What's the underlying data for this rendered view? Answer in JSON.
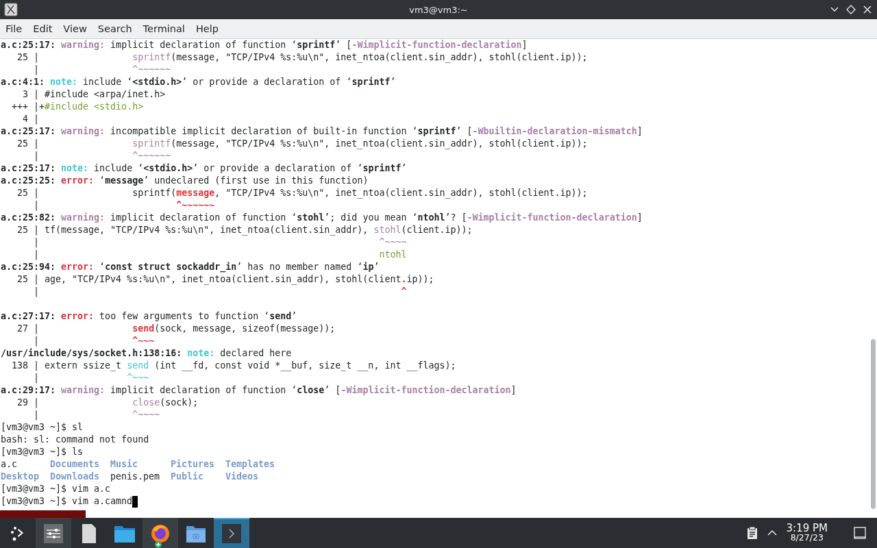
{
  "window": {
    "title": "vm3@vm3:~"
  },
  "menu": [
    "File",
    "Edit",
    "View",
    "Search",
    "Terminal",
    "Help"
  ],
  "terminal": {
    "lines": [
      {
        "kind": "output",
        "segments": [
          {
            "kind": "bold",
            "text": "a.c:25:17: "
          },
          {
            "kind": "warning",
            "text": "warning:"
          },
          {
            "kind": "plain",
            "text": " implicit declaration of function ‘"
          },
          {
            "kind": "bold",
            "text": "sprintf"
          },
          {
            "kind": "plain",
            "text": "’ ["
          },
          {
            "kind": "flag",
            "text": "-Wimplicit-function-declaration"
          },
          {
            "kind": "plain",
            "text": "]"
          }
        ]
      },
      {
        "kind": "output",
        "segments": [
          {
            "kind": "plain",
            "text": "   25 |                 "
          },
          {
            "kind": "code-warning",
            "text": "sprintf"
          },
          {
            "kind": "plain",
            "text": "(message, \"TCP/IPv4 %s:%u\\n\", inet_ntoa(client.sin_addr), stohl(client.ip));"
          }
        ]
      },
      {
        "kind": "output",
        "segments": [
          {
            "kind": "plain",
            "text": "      |                 "
          },
          {
            "kind": "code-warning",
            "text": "^~~~~~~"
          }
        ]
      },
      {
        "kind": "output",
        "segments": [
          {
            "kind": "bold",
            "text": "a.c:4:1: "
          },
          {
            "kind": "note",
            "text": "note:"
          },
          {
            "kind": "plain",
            "text": " include ‘"
          },
          {
            "kind": "bold",
            "text": "<stdio.h>"
          },
          {
            "kind": "plain",
            "text": "’ or provide a declaration of ‘"
          },
          {
            "kind": "bold",
            "text": "sprintf"
          },
          {
            "kind": "plain",
            "text": "’"
          }
        ]
      },
      {
        "kind": "output",
        "segments": [
          {
            "kind": "plain",
            "text": "    3 | #include <arpa/inet.h>"
          }
        ]
      },
      {
        "kind": "output",
        "segments": [
          {
            "kind": "plain",
            "text": "  +++ |+"
          },
          {
            "kind": "fixit",
            "text": "#include <stdio.h>"
          }
        ]
      },
      {
        "kind": "output",
        "segments": [
          {
            "kind": "plain",
            "text": "    4 |"
          }
        ]
      },
      {
        "kind": "output",
        "segments": [
          {
            "kind": "bold",
            "text": "a.c:25:17: "
          },
          {
            "kind": "warning",
            "text": "warning:"
          },
          {
            "kind": "plain",
            "text": " incompatible implicit declaration of built-in function ‘"
          },
          {
            "kind": "bold",
            "text": "sprintf"
          },
          {
            "kind": "plain",
            "text": "’ ["
          },
          {
            "kind": "flag",
            "text": "-Wbuiltin-declaration-mismatch"
          },
          {
            "kind": "plain",
            "text": "]"
          }
        ]
      },
      {
        "kind": "output",
        "segments": [
          {
            "kind": "plain",
            "text": "   25 |                 "
          },
          {
            "kind": "code-warning",
            "text": "sprintf"
          },
          {
            "kind": "plain",
            "text": "(message, \"TCP/IPv4 %s:%u\\n\", inet_ntoa(client.sin_addr), stohl(client.ip));"
          }
        ]
      },
      {
        "kind": "output",
        "segments": [
          {
            "kind": "plain",
            "text": "      |                 "
          },
          {
            "kind": "code-warning",
            "text": "^~~~~~~"
          }
        ]
      },
      {
        "kind": "output",
        "segments": [
          {
            "kind": "bold",
            "text": "a.c:25:17: "
          },
          {
            "kind": "note",
            "text": "note:"
          },
          {
            "kind": "plain",
            "text": " include ‘"
          },
          {
            "kind": "bold",
            "text": "<stdio.h>"
          },
          {
            "kind": "plain",
            "text": "’ or provide a declaration of ‘"
          },
          {
            "kind": "bold",
            "text": "sprintf"
          },
          {
            "kind": "plain",
            "text": "’"
          }
        ]
      },
      {
        "kind": "output",
        "segments": [
          {
            "kind": "bold",
            "text": "a.c:25:25: "
          },
          {
            "kind": "error",
            "text": "error:"
          },
          {
            "kind": "plain",
            "text": " ‘"
          },
          {
            "kind": "bold",
            "text": "message"
          },
          {
            "kind": "plain",
            "text": "’ undeclared (first use in this function)"
          }
        ]
      },
      {
        "kind": "output",
        "segments": [
          {
            "kind": "plain",
            "text": "   25 |                 sprintf("
          },
          {
            "kind": "code-error",
            "text": "message"
          },
          {
            "kind": "plain",
            "text": ", \"TCP/IPv4 %s:%u\\n\", inet_ntoa(client.sin_addr), stohl(client.ip));"
          }
        ]
      },
      {
        "kind": "output",
        "segments": [
          {
            "kind": "plain",
            "text": "      |                         "
          },
          {
            "kind": "code-error",
            "text": "^~~~~~~"
          }
        ]
      },
      {
        "kind": "output",
        "segments": [
          {
            "kind": "bold",
            "text": "a.c:25:82: "
          },
          {
            "kind": "warning",
            "text": "warning:"
          },
          {
            "kind": "plain",
            "text": " implicit declaration of function ‘"
          },
          {
            "kind": "bold",
            "text": "stohl"
          },
          {
            "kind": "plain",
            "text": "’; did you mean ‘"
          },
          {
            "kind": "bold",
            "text": "ntohl"
          },
          {
            "kind": "plain",
            "text": "’? ["
          },
          {
            "kind": "flag",
            "text": "-Wimplicit-function-declaration"
          },
          {
            "kind": "plain",
            "text": "]"
          }
        ]
      },
      {
        "kind": "output",
        "segments": [
          {
            "kind": "plain",
            "text": "   25 | tf(message, \"TCP/IPv4 %s:%u\\n\", inet_ntoa(client.sin_addr), "
          },
          {
            "kind": "code-warning",
            "text": "stohl"
          },
          {
            "kind": "plain",
            "text": "(client.ip));"
          }
        ]
      },
      {
        "kind": "output",
        "segments": [
          {
            "kind": "plain",
            "text": "      |                                                              "
          },
          {
            "kind": "code-warning",
            "text": "^~~~~"
          }
        ]
      },
      {
        "kind": "output",
        "segments": [
          {
            "kind": "plain",
            "text": "      |                                                              "
          },
          {
            "kind": "fixit",
            "text": "ntohl"
          }
        ]
      },
      {
        "kind": "output",
        "segments": [
          {
            "kind": "bold",
            "text": "a.c:25:94: "
          },
          {
            "kind": "error",
            "text": "error:"
          },
          {
            "kind": "plain",
            "text": " ‘"
          },
          {
            "kind": "bold",
            "text": "const struct sockaddr_in"
          },
          {
            "kind": "plain",
            "text": "’ has no member named ‘"
          },
          {
            "kind": "bold",
            "text": "ip"
          },
          {
            "kind": "plain",
            "text": "’"
          }
        ]
      },
      {
        "kind": "output",
        "segments": [
          {
            "kind": "plain",
            "text": "   25 | age, \"TCP/IPv4 %s:%u\\n\", inet_ntoa(client.sin_addr), stohl(client"
          },
          {
            "kind": "code-error",
            "text": "."
          },
          {
            "kind": "plain",
            "text": "ip));"
          }
        ]
      },
      {
        "kind": "output",
        "segments": [
          {
            "kind": "plain",
            "text": "      |                                                                  "
          },
          {
            "kind": "code-error",
            "text": "^"
          }
        ]
      },
      {
        "kind": "blank"
      },
      {
        "kind": "output",
        "segments": [
          {
            "kind": "bold",
            "text": "a.c:27:17: "
          },
          {
            "kind": "error",
            "text": "error:"
          },
          {
            "kind": "plain",
            "text": " too few arguments to function ‘"
          },
          {
            "kind": "bold",
            "text": "send"
          },
          {
            "kind": "plain",
            "text": "’"
          }
        ]
      },
      {
        "kind": "output",
        "segments": [
          {
            "kind": "plain",
            "text": "   27 |                 "
          },
          {
            "kind": "code-error",
            "text": "send"
          },
          {
            "kind": "plain",
            "text": "(sock, message, sizeof(message));"
          }
        ]
      },
      {
        "kind": "output",
        "segments": [
          {
            "kind": "plain",
            "text": "      |                 "
          },
          {
            "kind": "code-error",
            "text": "^~~~"
          }
        ]
      },
      {
        "kind": "output",
        "segments": [
          {
            "kind": "bold",
            "text": "/usr/include/sys/socket.h:138:16: "
          },
          {
            "kind": "note",
            "text": "note:"
          },
          {
            "kind": "plain",
            "text": " declared here"
          }
        ]
      },
      {
        "kind": "output",
        "segments": [
          {
            "kind": "plain",
            "text": "  138 | extern ssize_t "
          },
          {
            "kind": "code-note",
            "text": "send"
          },
          {
            "kind": "plain",
            "text": " (int __fd, const void *__buf, size_t __n, int __flags);"
          }
        ]
      },
      {
        "kind": "output",
        "segments": [
          {
            "kind": "plain",
            "text": "      |                "
          },
          {
            "kind": "code-note",
            "text": "^~~~"
          }
        ]
      },
      {
        "kind": "output",
        "segments": [
          {
            "kind": "bold",
            "text": "a.c:29:17: "
          },
          {
            "kind": "warning",
            "text": "warning:"
          },
          {
            "kind": "plain",
            "text": " implicit declaration of function ‘"
          },
          {
            "kind": "bold",
            "text": "close"
          },
          {
            "kind": "plain",
            "text": "’ ["
          },
          {
            "kind": "flag",
            "text": "-Wimplicit-function-declaration"
          },
          {
            "kind": "plain",
            "text": "]"
          }
        ]
      },
      {
        "kind": "output",
        "segments": [
          {
            "kind": "plain",
            "text": "   29 |                 "
          },
          {
            "kind": "code-warning",
            "text": "close"
          },
          {
            "kind": "plain",
            "text": "(sock);"
          }
        ]
      },
      {
        "kind": "output",
        "segments": [
          {
            "kind": "plain",
            "text": "      |                 "
          },
          {
            "kind": "code-warning",
            "text": "^~~~~"
          }
        ]
      },
      {
        "kind": "output",
        "segments": [
          {
            "kind": "plain",
            "text": "[vm3@vm3 ~]$ sl"
          }
        ]
      },
      {
        "kind": "output",
        "segments": [
          {
            "kind": "plain",
            "text": "bash: sl: command not found"
          }
        ]
      },
      {
        "kind": "output",
        "segments": [
          {
            "kind": "plain",
            "text": "[vm3@vm3 ~]$ ls"
          }
        ]
      },
      {
        "kind": "listing",
        "entries": [
          {
            "kind": "file",
            "text": "a.c"
          },
          {
            "kind": "directory",
            "text": "Documents"
          },
          {
            "kind": "directory",
            "text": "Music"
          },
          {
            "kind": "directory",
            "text": "Pictures"
          },
          {
            "kind": "directory",
            "text": "Templates"
          }
        ]
      },
      {
        "kind": "listing",
        "entries": [
          {
            "kind": "directory",
            "text": "Desktop"
          },
          {
            "kind": "directory",
            "text": "Downloads"
          },
          {
            "kind": "file",
            "text": "penis.pem"
          },
          {
            "kind": "directory",
            "text": "Public"
          },
          {
            "kind": "directory",
            "text": "Videos"
          }
        ]
      },
      {
        "kind": "output",
        "segments": [
          {
            "kind": "plain",
            "text": "[vm3@vm3 ~]$ vim a.c"
          }
        ]
      },
      {
        "kind": "output",
        "segments": [
          {
            "kind": "plain",
            "text": "[vm3@vm3 ~]$ vim a.camnd"
          }
        ],
        "cursor": true
      }
    ]
  },
  "taskbar": {
    "apps": [
      {
        "kind": "launcher",
        "highlighted": false,
        "selected": false
      },
      {
        "kind": "settings",
        "highlighted": true,
        "selected": false
      },
      {
        "kind": "document",
        "highlighted": false,
        "selected": false
      },
      {
        "kind": "folder",
        "highlighted": false,
        "selected": false
      },
      {
        "kind": "browser",
        "highlighted": true,
        "selected": false
      },
      {
        "kind": "camera-folder",
        "highlighted": false,
        "selected": false
      },
      {
        "kind": "terminal",
        "highlighted": false,
        "selected": true
      }
    ],
    "clock": {
      "time": "3:19 PM",
      "date": "8/27/23"
    }
  }
}
